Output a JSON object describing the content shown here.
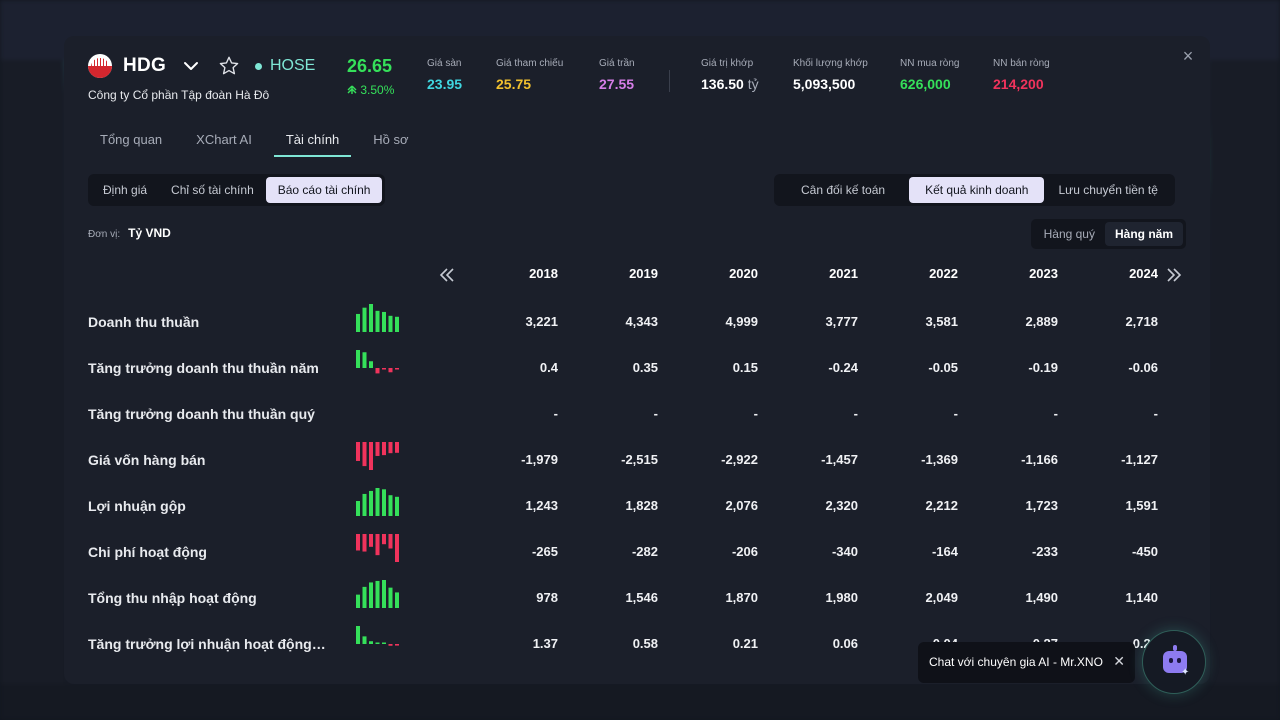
{
  "stock": {
    "ticker": "HDG",
    "exchange": "HOSE",
    "company_name": "Công ty Cổ phần Tập đoàn Hà Đô",
    "price": "26.65",
    "change_pct": "3.50%"
  },
  "stats": [
    {
      "label": "Giá sàn",
      "value": "23.95",
      "color": "#3fd6e0"
    },
    {
      "label": "Giá tham chiếu",
      "value": "25.75",
      "color": "#f2c12e"
    },
    {
      "label": "Giá trần",
      "value": "27.55",
      "color": "#d77ee8"
    },
    {
      "label": "Giá trị khớp",
      "value": "136.50",
      "unit": "tỷ",
      "color": "#ffffff"
    },
    {
      "label": "Khối lượng khớp",
      "value": "5,093,500",
      "color": "#ffffff"
    },
    {
      "label": "NN mua ròng",
      "value": "626,000",
      "color": "#35e05a"
    },
    {
      "label": "NN bán ròng",
      "value": "214,200",
      "color": "#f0335c"
    }
  ],
  "tabs": [
    "Tổng quan",
    "XChart AI",
    "Tài chính",
    "Hồ sơ"
  ],
  "active_tab": "Tài chính",
  "sub_tabs": [
    "Định giá",
    "Chỉ số tài chính",
    "Báo cáo tài chính"
  ],
  "active_sub_tab": "Báo cáo tài chính",
  "report_tabs": [
    "Cân đối kế toán",
    "Kết quả kinh doanh",
    "Lưu chuyển tiền tệ"
  ],
  "active_report_tab": "Kết quả kinh doanh",
  "unit": {
    "label": "Đơn vị:",
    "value": "Tỷ VND"
  },
  "period_tabs": [
    "Hàng quý",
    "Hàng năm"
  ],
  "active_period": "Hàng năm",
  "years": [
    "2018",
    "2019",
    "2020",
    "2021",
    "2022",
    "2023",
    "2024"
  ],
  "rows": [
    {
      "label": "Doanh thu thuần",
      "values": [
        "3,221",
        "4,343",
        "4,999",
        "3,777",
        "3,581",
        "2,889",
        "2,718"
      ],
      "spark": [
        3221,
        4343,
        4999,
        3777,
        3581,
        2889,
        2718
      ],
      "spark_type": "pos"
    },
    {
      "label": "Tăng trưởng doanh thu thuần năm",
      "values": [
        "0.4",
        "0.35",
        "0.15",
        "-0.24",
        "-0.05",
        "-0.19",
        "-0.06"
      ],
      "spark": [
        0.4,
        0.35,
        0.15,
        -0.24,
        -0.05,
        -0.19,
        -0.06
      ],
      "spark_type": "mixed"
    },
    {
      "label": "Tăng trưởng doanh thu thuần quý",
      "values": [
        "-",
        "-",
        "-",
        "-",
        "-",
        "-",
        "-"
      ],
      "spark": [],
      "spark_type": "none"
    },
    {
      "label": "Giá vốn hàng bán",
      "values": [
        "-1,979",
        "-2,515",
        "-2,922",
        "-1,457",
        "-1,369",
        "-1,166",
        "-1,127"
      ],
      "spark": [
        -1979,
        -2515,
        -2922,
        -1457,
        -1369,
        -1166,
        -1127
      ],
      "spark_type": "neg"
    },
    {
      "label": "Lợi nhuận gộp",
      "values": [
        "1,243",
        "1,828",
        "2,076",
        "2,320",
        "2,212",
        "1,723",
        "1,591"
      ],
      "spark": [
        1243,
        1828,
        2076,
        2320,
        2212,
        1723,
        1591
      ],
      "spark_type": "pos"
    },
    {
      "label": "Chi phí hoạt động",
      "values": [
        "-265",
        "-282",
        "-206",
        "-340",
        "-164",
        "-233",
        "-450"
      ],
      "spark": [
        -265,
        -282,
        -206,
        -340,
        -164,
        -233,
        -450
      ],
      "spark_type": "neg"
    },
    {
      "label": "Tổng thu nhập hoạt động",
      "values": [
        "978",
        "1,546",
        "1,870",
        "1,980",
        "2,049",
        "1,490",
        "1,140"
      ],
      "spark": [
        978,
        1546,
        1870,
        1980,
        2049,
        1490,
        1140
      ],
      "spark_type": "pos"
    },
    {
      "label": "Tăng trưởng lợi nhuận hoạt động n...",
      "values": [
        "1.37",
        "0.58",
        "0.21",
        "0.06",
        "0.04",
        "-0.27",
        "-0.24"
      ],
      "spark": [
        1.37,
        0.58,
        0.21,
        0.06,
        0.04,
        -0.27,
        -0.24
      ],
      "spark_type": "mixed"
    }
  ],
  "chat": {
    "label": "Chat với chuyên gia AI - Mr.XNO"
  },
  "colors": {
    "up": "#35e05a",
    "down": "#f0335c",
    "accent": "#7fe6d5"
  }
}
